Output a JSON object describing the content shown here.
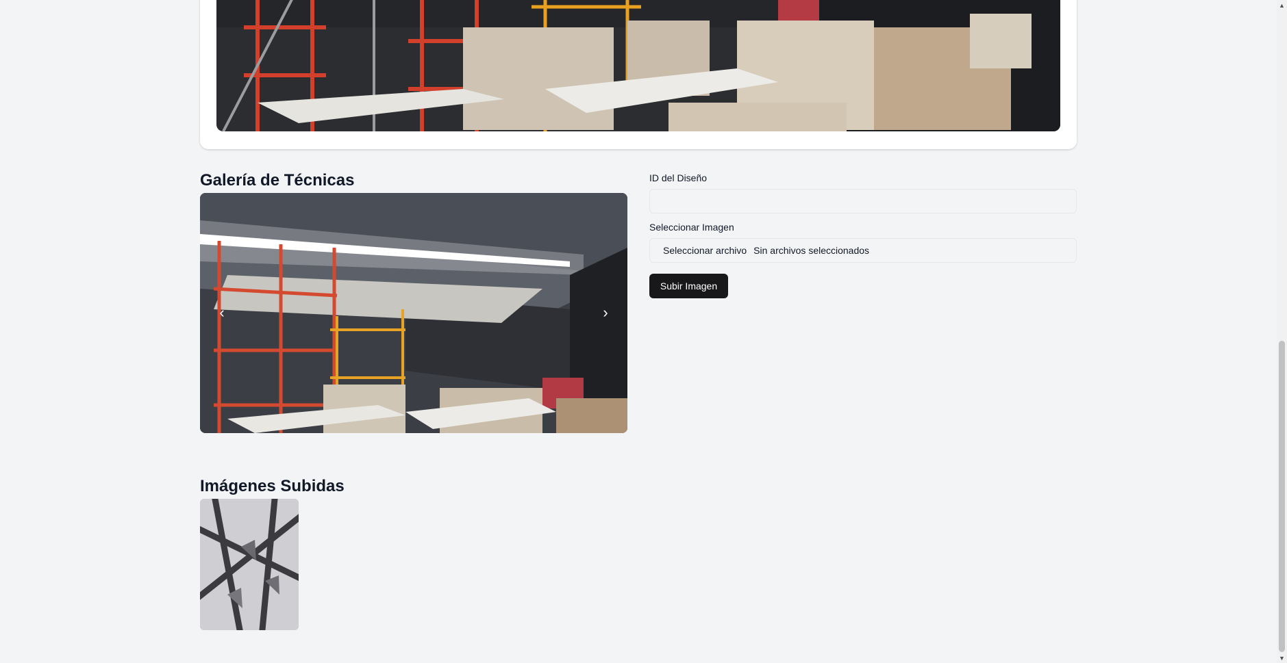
{
  "gallery": {
    "title": "Galería de Técnicas",
    "prev_icon": "‹",
    "next_icon": "›"
  },
  "form": {
    "design_id_label": "ID del Diseño",
    "design_id_value": "",
    "image_label": "Seleccionar Imagen",
    "file_button": "Seleccionar archivo",
    "file_status": "Sin archivos seleccionados",
    "submit_label": "Subir Imagen"
  },
  "uploaded": {
    "title": "Imágenes Subidas"
  },
  "colors": {
    "background": "#f3f4f6",
    "primary_button": "#18181b",
    "text": "#111827"
  }
}
